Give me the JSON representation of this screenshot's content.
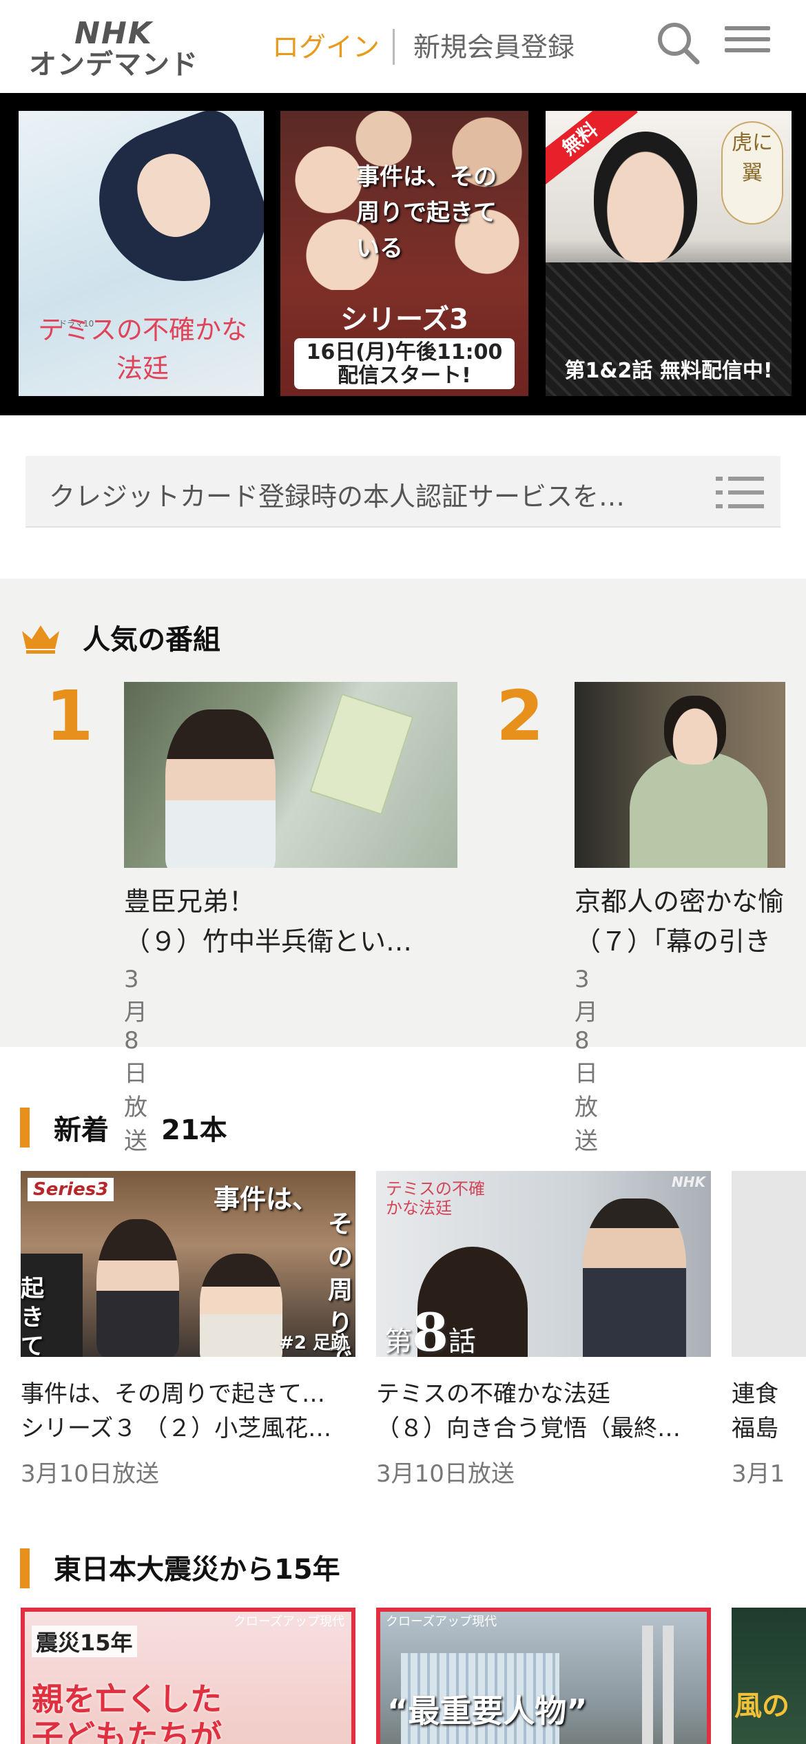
{
  "header": {
    "logo_line1": "NHK",
    "logo_line2": "オンデマンド",
    "login_label": "ログイン",
    "register_label": "新規会員登録",
    "accent_color": "#e89a1c"
  },
  "hero": {
    "banners": [
      {
        "title": "テミスの不確かな法廷",
        "label": "ドラマ10"
      },
      {
        "headline": "事件は、その周りで起きている",
        "series": "シリーズ3",
        "box_line1": "16日(月)午後11:00",
        "box_line2": "配信スタート!"
      },
      {
        "free": "無料",
        "seal": "虎に翼",
        "caption": "第1&2話 無料配信中!"
      }
    ]
  },
  "notice": {
    "text": "クレジットカード登録時の本人認証サービスを…"
  },
  "popular": {
    "title": "人気の番組",
    "items": [
      {
        "rank": "1",
        "title_line1": "豊臣兄弟！",
        "title_line2": "（９）竹中半兵衛とい…",
        "date": "3月8日放送"
      },
      {
        "rank": "2",
        "title_line1": "京都人の密かな愉",
        "title_line2": "（７）「幕の引き",
        "date": "3月8日放送"
      }
    ]
  },
  "new_section": {
    "title": "新着",
    "count": "21本",
    "cards": [
      {
        "tag": "Series3",
        "headline_a": "事件は、",
        "headline_b": "その周りで",
        "headline_c": "起きている",
        "ep": "#2 足跡",
        "title_line1": "事件は、その周りで起きて…",
        "title_line2": "シリーズ３ （２）小芝風花…",
        "date": "3月10日放送"
      },
      {
        "logo": "テミスの不確かな法廷",
        "ep_prefix": "第",
        "ep_num": "8",
        "ep_suffix": "話",
        "title_line1": "テミスの不確かな法廷",
        "title_line2": "（８）向き合う覚悟（最終…",
        "date": "3月10日放送"
      },
      {
        "title_line1": "連食",
        "title_line2": "福島",
        "date": "3月1"
      }
    ]
  },
  "quake_section": {
    "title": "東日本大震災から15年",
    "cards": [
      {
        "label": "クローズアップ現代",
        "tag": "震災15年",
        "headline": "親を亡くした子どもたちが"
      },
      {
        "label": "クローズアップ現代",
        "headline": "“最重要人物”"
      },
      {
        "headline": "風の"
      }
    ]
  }
}
